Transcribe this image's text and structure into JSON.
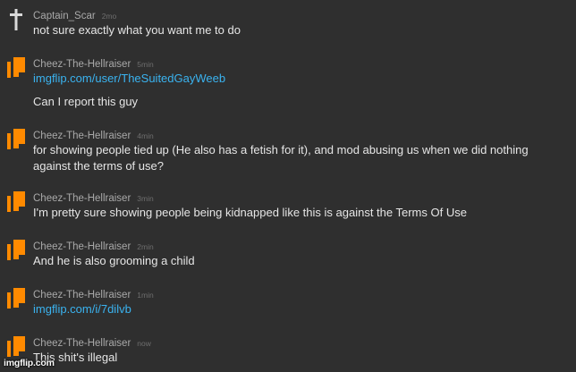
{
  "comments": [
    {
      "username": "Captain_Scar",
      "time": "2mo",
      "avatar_icon": "cross-icon",
      "lines": [
        {
          "text": "not sure exactly what you want me to do",
          "kind": "text"
        }
      ]
    },
    {
      "username": "Cheez-The-Hellraiser",
      "time": "5min",
      "avatar_icon": "orange-flag-icon",
      "lines": [
        {
          "text": "imgflip.com/user/TheSuitedGayWeeb",
          "kind": "link"
        },
        {
          "text": "Can I report this guy",
          "kind": "text"
        }
      ]
    },
    {
      "username": "Cheez-The-Hellraiser",
      "time": "4min",
      "avatar_icon": "orange-flag-icon",
      "lines": [
        {
          "text": "for showing people tied up (He also has a fetish for it), and mod abusing us when we did nothing",
          "kind": "text"
        },
        {
          "text": "against the terms of use?",
          "kind": "text"
        }
      ]
    },
    {
      "username": "Cheez-The-Hellraiser",
      "time": "3min",
      "avatar_icon": "orange-flag-icon",
      "lines": [
        {
          "text": "I'm pretty sure showing people being kidnapped like this is against the Terms Of Use",
          "kind": "text"
        }
      ]
    },
    {
      "username": "Cheez-The-Hellraiser",
      "time": "2min",
      "avatar_icon": "orange-flag-icon",
      "lines": [
        {
          "text": "And he is also grooming a child",
          "kind": "text"
        }
      ]
    },
    {
      "username": "Cheez-The-Hellraiser",
      "time": "1min",
      "avatar_icon": "orange-flag-icon",
      "lines": [
        {
          "text": "imgflip.com/i/7dilvb",
          "kind": "link"
        }
      ]
    },
    {
      "username": "Cheez-The-Hellraiser",
      "time": "now",
      "avatar_icon": "orange-flag-icon",
      "lines": [
        {
          "text": "This shit's illegal",
          "kind": "text"
        }
      ]
    }
  ],
  "watermark": "imgflip.com",
  "colors": {
    "background": "#2f2f2f",
    "username": "#a9a9a9",
    "time": "#6e6e6e",
    "text": "#e6e6e6",
    "link": "#3ab3f0",
    "flag_orange": "#ff8a00"
  }
}
